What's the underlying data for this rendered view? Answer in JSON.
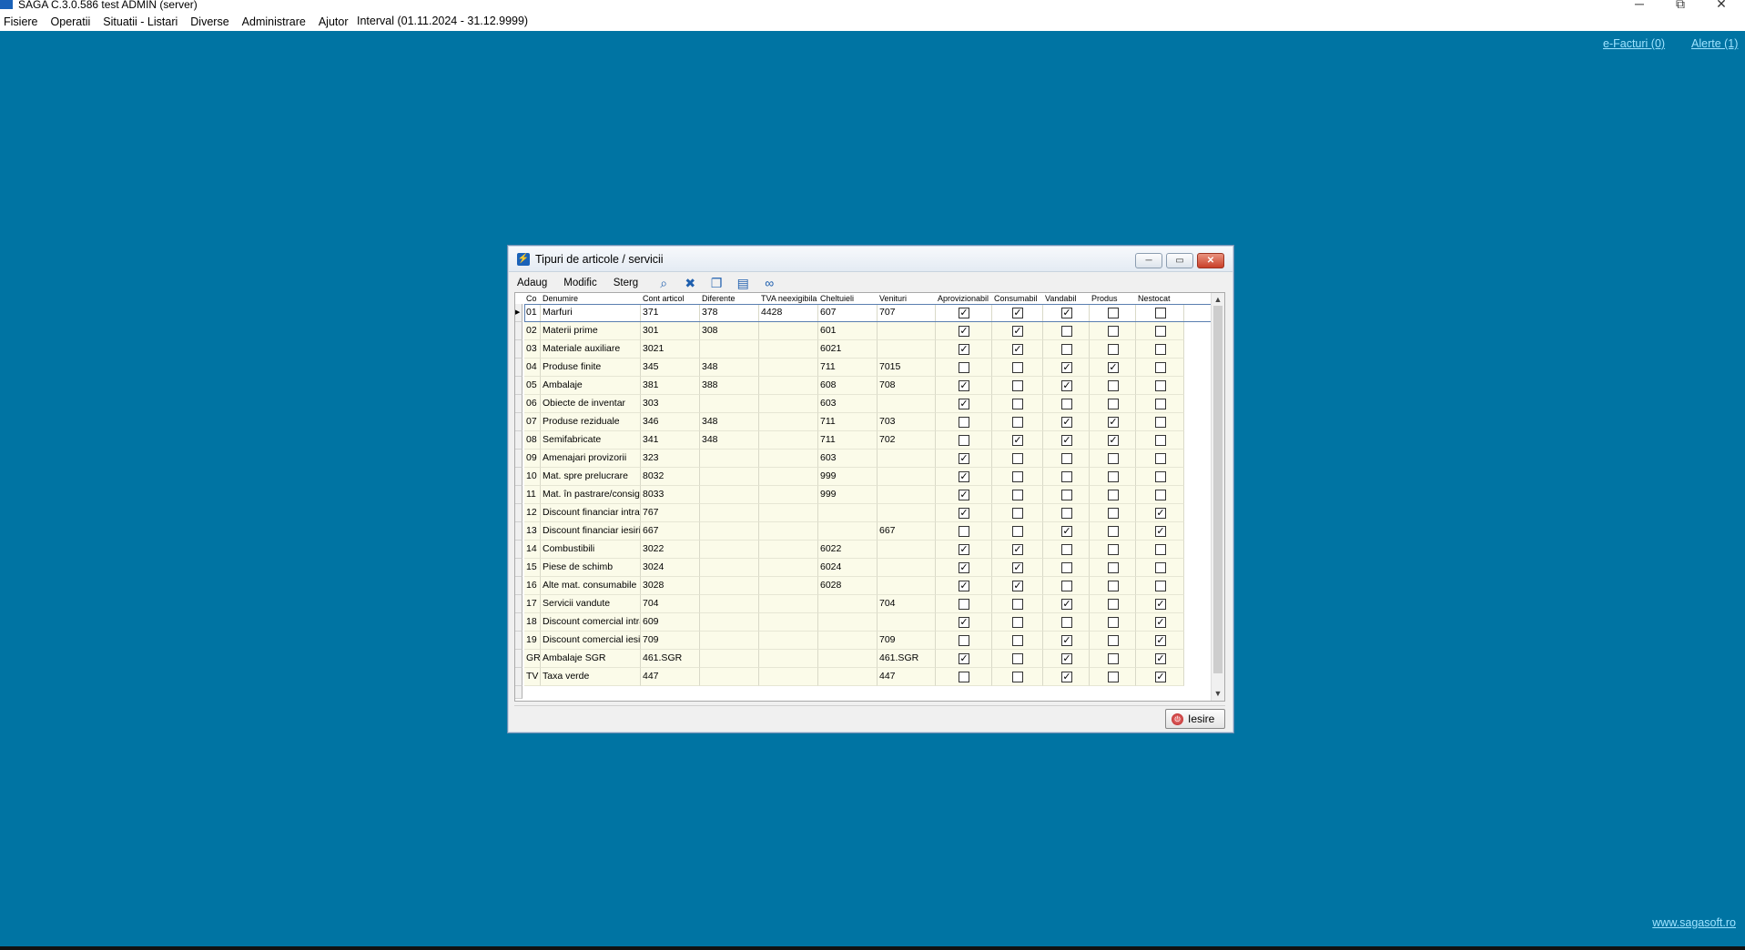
{
  "window": {
    "title": "SAGA C.3.0.586  test  ADMIN    (server)",
    "minimize": "─",
    "restore": "⧉",
    "close": "✕"
  },
  "menu": [
    "Fisiere",
    "Operatii",
    "Situatii - Listari",
    "Diverse",
    "Administrare",
    "Ajutor"
  ],
  "interval": "Interval (01.11.2024 - 31.12.9999)",
  "links": {
    "efacturi": "e-Facturi (0)",
    "alerte": "Alerte (1)",
    "site": "www.sagasoft.ro"
  },
  "dialog": {
    "title": "Tipuri de articole / servicii",
    "toolbar": {
      "add": "Adaug",
      "modify": "Modific",
      "delete": "Sterg"
    },
    "exit": "Iesire"
  },
  "table": {
    "headers": [
      "Co",
      "Denumire",
      "Cont articol",
      "Diferente",
      "TVA neexigibila",
      "Cheltuieli",
      "Venituri",
      "Aprovizionabil",
      "Consumabil",
      "Vandabil",
      "Produs",
      "Nestocat"
    ],
    "rows": [
      {
        "cod": "01",
        "den": "Marfuri",
        "cont": "371",
        "dif": "378",
        "tva": "4428",
        "chelt": "607",
        "ven": "707",
        "flags": [
          1,
          1,
          1,
          0,
          0
        ]
      },
      {
        "cod": "02",
        "den": "Materii prime",
        "cont": "301",
        "dif": "308",
        "tva": "",
        "chelt": "601",
        "ven": "",
        "flags": [
          1,
          1,
          0,
          0,
          0
        ]
      },
      {
        "cod": "03",
        "den": "Materiale auxiliare",
        "cont": "3021",
        "dif": "",
        "tva": "",
        "chelt": "6021",
        "ven": "",
        "flags": [
          1,
          1,
          0,
          0,
          0
        ]
      },
      {
        "cod": "04",
        "den": "Produse finite",
        "cont": "345",
        "dif": "348",
        "tva": "",
        "chelt": "711",
        "ven": "7015",
        "flags": [
          0,
          0,
          1,
          1,
          0
        ]
      },
      {
        "cod": "05",
        "den": "Ambalaje",
        "cont": "381",
        "dif": "388",
        "tva": "",
        "chelt": "608",
        "ven": "708",
        "flags": [
          1,
          0,
          1,
          0,
          0
        ]
      },
      {
        "cod": "06",
        "den": "Obiecte de inventar",
        "cont": "303",
        "dif": "",
        "tva": "",
        "chelt": "603",
        "ven": "",
        "flags": [
          1,
          0,
          0,
          0,
          0
        ]
      },
      {
        "cod": "07",
        "den": "Produse reziduale",
        "cont": "346",
        "dif": "348",
        "tva": "",
        "chelt": "711",
        "ven": "703",
        "flags": [
          0,
          0,
          1,
          1,
          0
        ]
      },
      {
        "cod": "08",
        "den": "Semifabricate",
        "cont": "341",
        "dif": "348",
        "tva": "",
        "chelt": "711",
        "ven": "702",
        "flags": [
          0,
          1,
          1,
          1,
          0
        ]
      },
      {
        "cod": "09",
        "den": "Amenajari provizorii",
        "cont": "323",
        "dif": "",
        "tva": "",
        "chelt": "603",
        "ven": "",
        "flags": [
          1,
          0,
          0,
          0,
          0
        ]
      },
      {
        "cod": "10",
        "den": "Mat. spre prelucrare",
        "cont": "8032",
        "dif": "",
        "tva": "",
        "chelt": "999",
        "ven": "",
        "flags": [
          1,
          0,
          0,
          0,
          0
        ]
      },
      {
        "cod": "11",
        "den": "Mat. în pastrare/consig.",
        "cont": "8033",
        "dif": "",
        "tva": "",
        "chelt": "999",
        "ven": "",
        "flags": [
          1,
          0,
          0,
          0,
          0
        ]
      },
      {
        "cod": "12",
        "den": "Discount financiar intrari",
        "cont": "767",
        "dif": "",
        "tva": "",
        "chelt": "",
        "ven": "",
        "flags": [
          1,
          0,
          0,
          0,
          1
        ]
      },
      {
        "cod": "13",
        "den": "Discount financiar iesiri",
        "cont": "667",
        "dif": "",
        "tva": "",
        "chelt": "",
        "ven": "667",
        "flags": [
          0,
          0,
          1,
          0,
          1
        ]
      },
      {
        "cod": "14",
        "den": "Combustibili",
        "cont": "3022",
        "dif": "",
        "tva": "",
        "chelt": "6022",
        "ven": "",
        "flags": [
          1,
          1,
          0,
          0,
          0
        ]
      },
      {
        "cod": "15",
        "den": "Piese de schimb",
        "cont": "3024",
        "dif": "",
        "tva": "",
        "chelt": "6024",
        "ven": "",
        "flags": [
          1,
          1,
          0,
          0,
          0
        ]
      },
      {
        "cod": "16",
        "den": "Alte mat. consumabile",
        "cont": "3028",
        "dif": "",
        "tva": "",
        "chelt": "6028",
        "ven": "",
        "flags": [
          1,
          1,
          0,
          0,
          0
        ]
      },
      {
        "cod": "17",
        "den": "Servicii vandute",
        "cont": "704",
        "dif": "",
        "tva": "",
        "chelt": "",
        "ven": "704",
        "flags": [
          0,
          0,
          1,
          0,
          1
        ]
      },
      {
        "cod": "18",
        "den": "Discount comercial intrari",
        "cont": "609",
        "dif": "",
        "tva": "",
        "chelt": "",
        "ven": "",
        "flags": [
          1,
          0,
          0,
          0,
          1
        ]
      },
      {
        "cod": "19",
        "den": "Discount comercial iesiri",
        "cont": "709",
        "dif": "",
        "tva": "",
        "chelt": "",
        "ven": "709",
        "flags": [
          0,
          0,
          1,
          0,
          1
        ]
      },
      {
        "cod": "GR",
        "den": "Ambalaje SGR",
        "cont": "461.SGR",
        "dif": "",
        "tva": "",
        "chelt": "",
        "ven": "461.SGR",
        "flags": [
          1,
          0,
          1,
          0,
          1
        ]
      },
      {
        "cod": "TV",
        "den": "Taxa verde",
        "cont": "447",
        "dif": "",
        "tva": "",
        "chelt": "",
        "ven": "447",
        "flags": [
          0,
          0,
          1,
          0,
          1
        ]
      }
    ]
  },
  "colors": {
    "desktop": "#0074a3",
    "row": "#fbfbe9",
    "link": "#9fe3ff"
  }
}
